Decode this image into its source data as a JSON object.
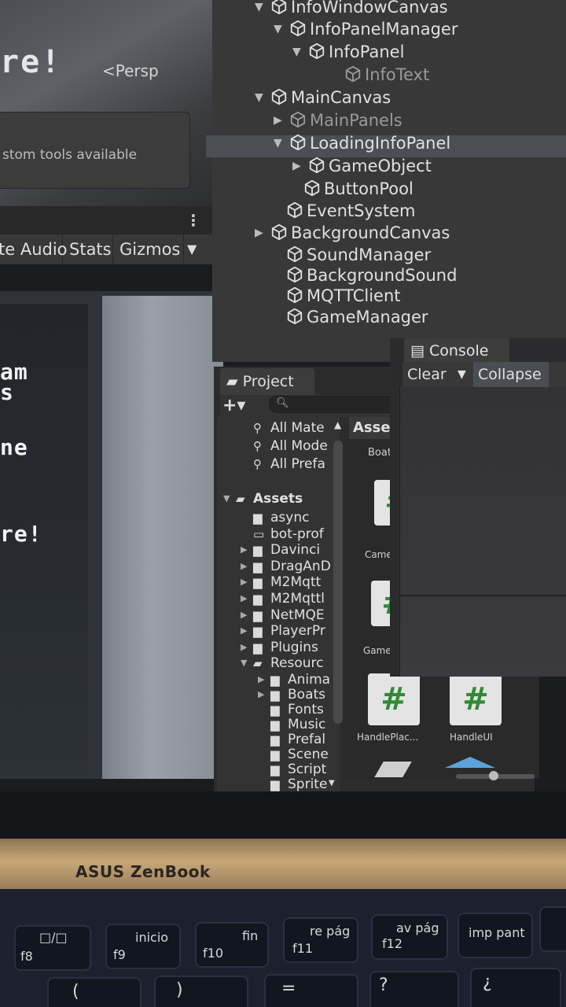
{
  "scene_view": {
    "overlay_text": "re!",
    "projection_label": "Persp",
    "tooltip_text": "stom tools available",
    "toolbar_buttons": [
      "te Audio",
      "Stats",
      "Gizmos"
    ],
    "menu_icon": "kebab-menu-icon",
    "dropdown_icon": "triangle-down-icon"
  },
  "game_view": {
    "lines": [
      "am",
      "s",
      "ne",
      "re!"
    ]
  },
  "hierarchy": {
    "items": [
      {
        "label": "InfoWindowCanvas",
        "expanded": true,
        "dim": false
      },
      {
        "label": "InfoPanelManager",
        "expanded": true,
        "dim": false
      },
      {
        "label": "InfoPanel",
        "expanded": true,
        "dim": false
      },
      {
        "label": "InfoText",
        "expanded": null,
        "dim": true
      },
      {
        "label": "MainCanvas",
        "expanded": true,
        "dim": false
      },
      {
        "label": "MainPanels",
        "expanded": false,
        "dim": true
      },
      {
        "label": "LoadingInfoPanel",
        "expanded": true,
        "dim": false,
        "selected": true
      },
      {
        "label": "GameObject",
        "expanded": false,
        "dim": false
      },
      {
        "label": "ButtonPool",
        "expanded": null,
        "dim": false
      },
      {
        "label": "EventSystem",
        "expanded": null,
        "dim": false
      },
      {
        "label": "BackgroundCanvas",
        "expanded": false,
        "dim": false
      },
      {
        "label": "SoundManager",
        "expanded": null,
        "dim": false
      },
      {
        "label": "BackgroundSound",
        "expanded": null,
        "dim": false
      },
      {
        "label": "MQTTClient",
        "expanded": null,
        "dim": false
      },
      {
        "label": "GameManager",
        "expanded": null,
        "dim": false
      }
    ]
  },
  "project": {
    "tab_label": "Project",
    "add_button": "+▾",
    "search_placeholder": "",
    "search_icon": "magnifier-icon",
    "favorites": [
      "All Mate",
      "All Mode",
      "All Prefa"
    ],
    "assets_root": "Assets",
    "folders": [
      "async",
      "bot-prof",
      "Davinci",
      "DragAnD",
      "M2Mqtt",
      "M2Mqttl",
      "NetMQE",
      "PlayerPr",
      "Plugins",
      "Resourc"
    ],
    "subfolders": [
      "Anima",
      "Boats",
      "Fonts",
      "Music",
      "Prefal",
      "Scene",
      "Script",
      "Sprite"
    ],
    "assets_header": "Assets",
    "asset_tiles": [
      {
        "label": "BoatE",
        "glyph": ""
      },
      {
        "label": "Came",
        "glyph": "#"
      },
      {
        "label": "Game",
        "glyph": "#"
      },
      {
        "label": "HandlePlac...",
        "glyph": "#"
      },
      {
        "label": "HandleUI",
        "glyph": "#"
      }
    ]
  },
  "console": {
    "tab_label": "Console",
    "tab_icon": "console-icon",
    "clear_label": "Clear",
    "collapse_label": "Collapse"
  },
  "laptop": {
    "brand": "ASUS ZenBook",
    "keys": [
      {
        "fn": "f8",
        "top": "□/□"
      },
      {
        "fn": "f9",
        "top": "inicio"
      },
      {
        "fn": "f10",
        "top": "fin"
      },
      {
        "fn": "f11",
        "top": "re pág"
      },
      {
        "fn": "f12",
        "top": "av pág"
      },
      {
        "fn": "",
        "top": "imp pant"
      }
    ],
    "lower_keys": [
      "(",
      ")",
      "=",
      "?",
      "¿"
    ]
  },
  "colors": {
    "editor_panel": "#383838",
    "selection": "#4b4f55",
    "prefab_hash": "#2f8b34",
    "hinge_gold": "#c7a87a"
  }
}
